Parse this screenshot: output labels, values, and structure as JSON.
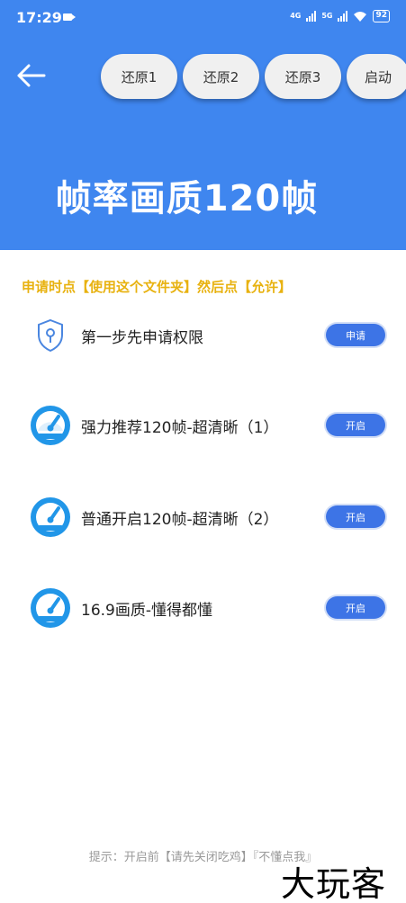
{
  "status_bar": {
    "time": "17:29",
    "network_1": "4G",
    "network_2": "5G",
    "battery": "92"
  },
  "header": {
    "back_icon": "arrow-left-icon",
    "buttons": [
      "还原1",
      "还原2",
      "还原3",
      "启动"
    ],
    "title": "帧率画质120帧",
    "bg_color": "#3f86ef"
  },
  "instruction": "申请时点【使用这个文件夹】然后点【允许】",
  "rows": [
    {
      "icon": "shield-icon",
      "label": "第一步先申请权限",
      "button": "申请"
    },
    {
      "icon": "speedometer-icon",
      "label": "强力推荐120帧-超清晰（1）",
      "button": "开启"
    },
    {
      "icon": "speedometer-icon",
      "label": "普通开启120帧-超清晰（2）",
      "button": "开启"
    },
    {
      "icon": "speedometer-icon",
      "label": "16.9画质-懂得都懂",
      "button": "开启"
    }
  ],
  "footer_tip": "提示：开启前【请先关闭吃鸡】『不懂点我』",
  "watermark": "大玩客"
}
